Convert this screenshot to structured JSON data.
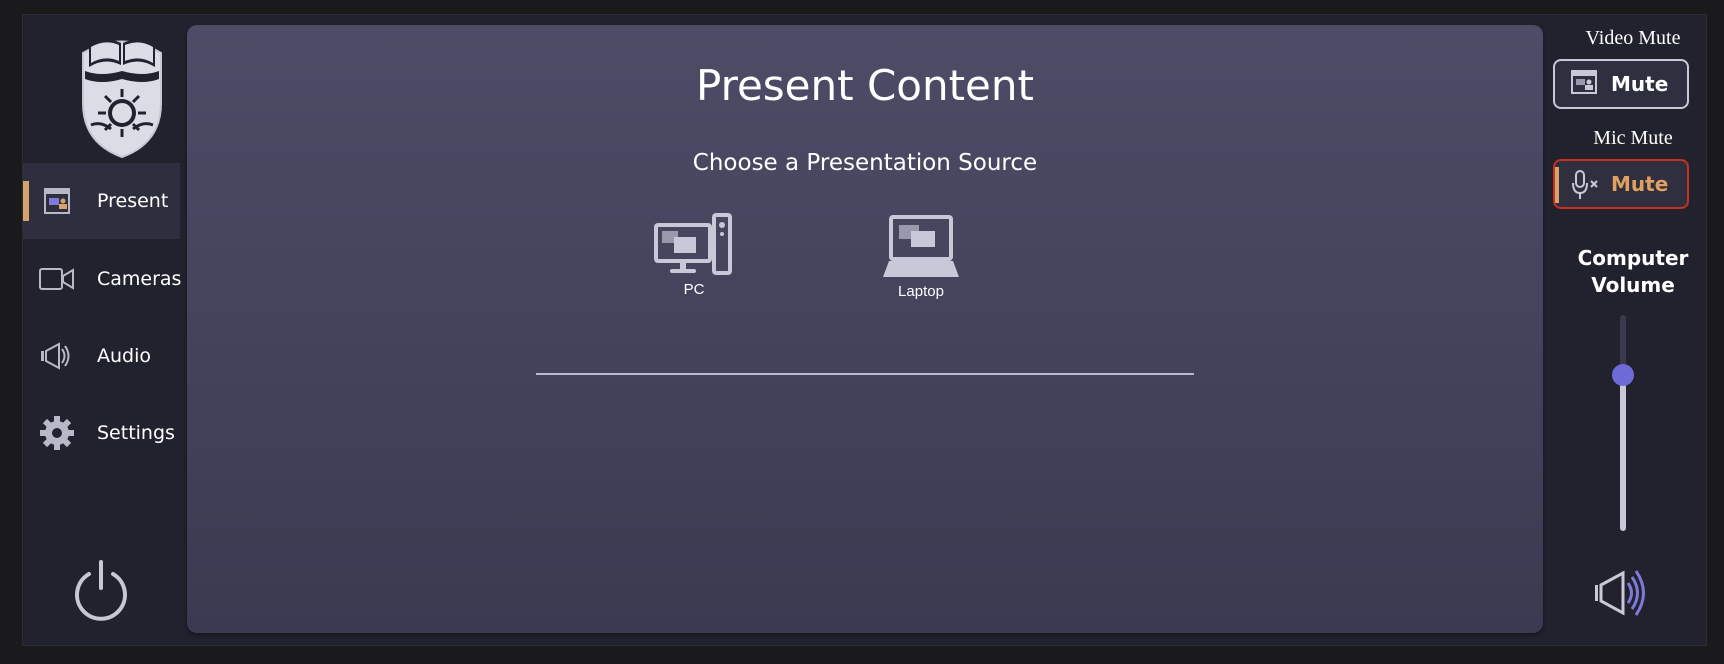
{
  "sidebar": {
    "items": [
      {
        "label": "Present",
        "icon": "present-icon",
        "active": true
      },
      {
        "label": "Cameras",
        "icon": "camera-icon",
        "active": false
      },
      {
        "label": "Audio",
        "icon": "speaker-icon",
        "active": false
      },
      {
        "label": "Settings",
        "icon": "gear-icon",
        "active": false
      }
    ],
    "power_icon": "power-icon"
  },
  "main": {
    "title": "Present Content",
    "subtitle": "Choose a Presentation Source",
    "sources": [
      {
        "label": "PC",
        "icon": "desktop-pc-icon"
      },
      {
        "label": "Laptop",
        "icon": "laptop-icon"
      }
    ]
  },
  "right": {
    "video_mute": {
      "heading": "Video Mute",
      "button_label": "Mute",
      "icon": "projector-screen-icon"
    },
    "mic_mute": {
      "heading": "Mic Mute",
      "button_label": "Mute",
      "icon": "mic-muted-icon"
    },
    "volume": {
      "title_line1": "Computer",
      "title_line2": "Volume",
      "level": 0.72
    },
    "speaker_icon": "speaker-volume-icon"
  },
  "colors": {
    "accent": "#d4a46a",
    "slider_thumb": "#6e6ad8",
    "mic_border": "#c8311f",
    "panel_top": "#4d4c66",
    "panel_bottom": "#3b3a51"
  }
}
